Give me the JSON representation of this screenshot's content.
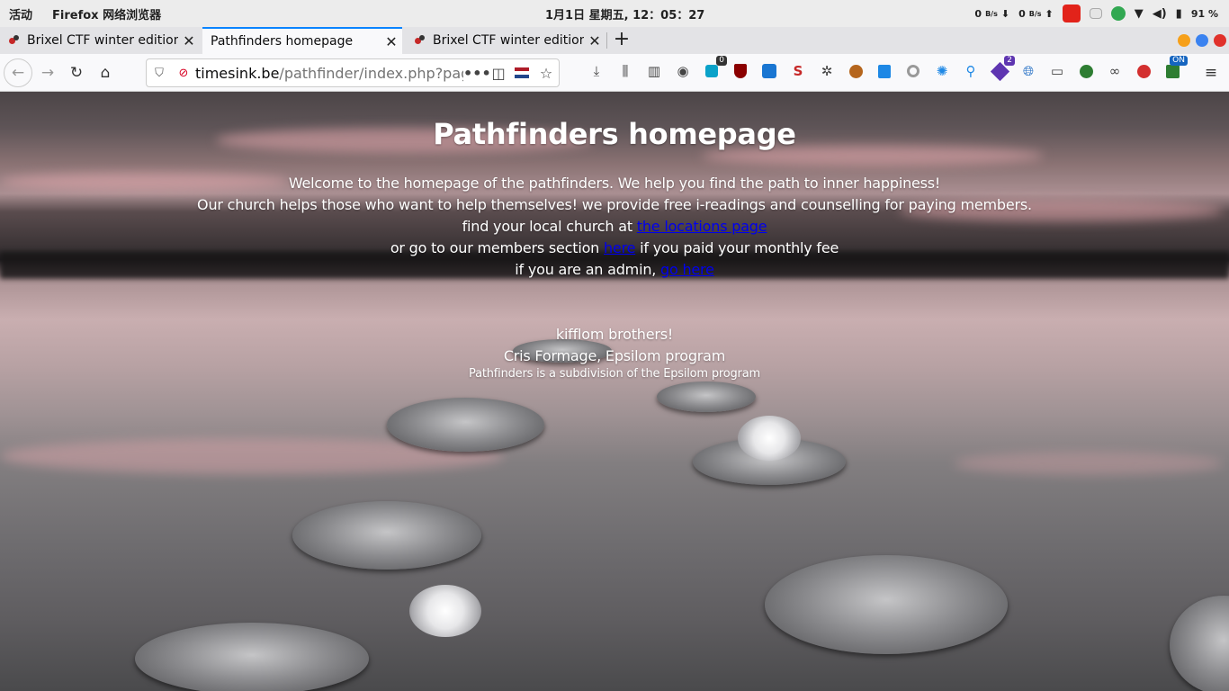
{
  "system_bar": {
    "activities": "活动",
    "app_name": "Firefox 网络浏览器",
    "clock": "1月1日 星期五, 12：05：27",
    "net_down": "0",
    "net_down_unit": "B/s",
    "net_up": "0",
    "net_up_unit": "B/s",
    "battery": "91 %"
  },
  "tabs": [
    {
      "title": "Brixel CTF winter edition",
      "active": false
    },
    {
      "title": "Pathfinders homepage",
      "active": true
    },
    {
      "title": "Brixel CTF winter edition",
      "active": false
    }
  ],
  "url": {
    "host": "timesink.be",
    "path": "/pathfinder/index.php?page"
  },
  "toolbar_badges": {
    "badge_a": "0",
    "badge_b": "2",
    "badge_c": "ON"
  },
  "page": {
    "title": "Pathfinders homepage",
    "line1": "Welcome to the homepage of the pathfinders. We help you find the path to inner happiness!",
    "line2": "Our church helps those who want to help themselves! we provide free i-readings and counselling for paying members.",
    "line3_prefix": "find your local church at ",
    "line3_link": "the locations page",
    "line4_prefix": "or go to our members section ",
    "line4_link": "here",
    "line4_suffix": " if you paid your monthly fee",
    "line5_prefix": "if you are an admin, ",
    "line5_link": "go here",
    "sig1": "kifflom brothers!",
    "sig2": "Cris Formage, Epsilom program",
    "sig3": "Pathfinders is a subdivision of the Epsilom program"
  },
  "colors": {
    "tab_accent": "#0a84ff",
    "link": "#0000ee",
    "win_min": "#f6a01a",
    "win_max": "#3a82f0",
    "win_close": "#e0312b"
  }
}
